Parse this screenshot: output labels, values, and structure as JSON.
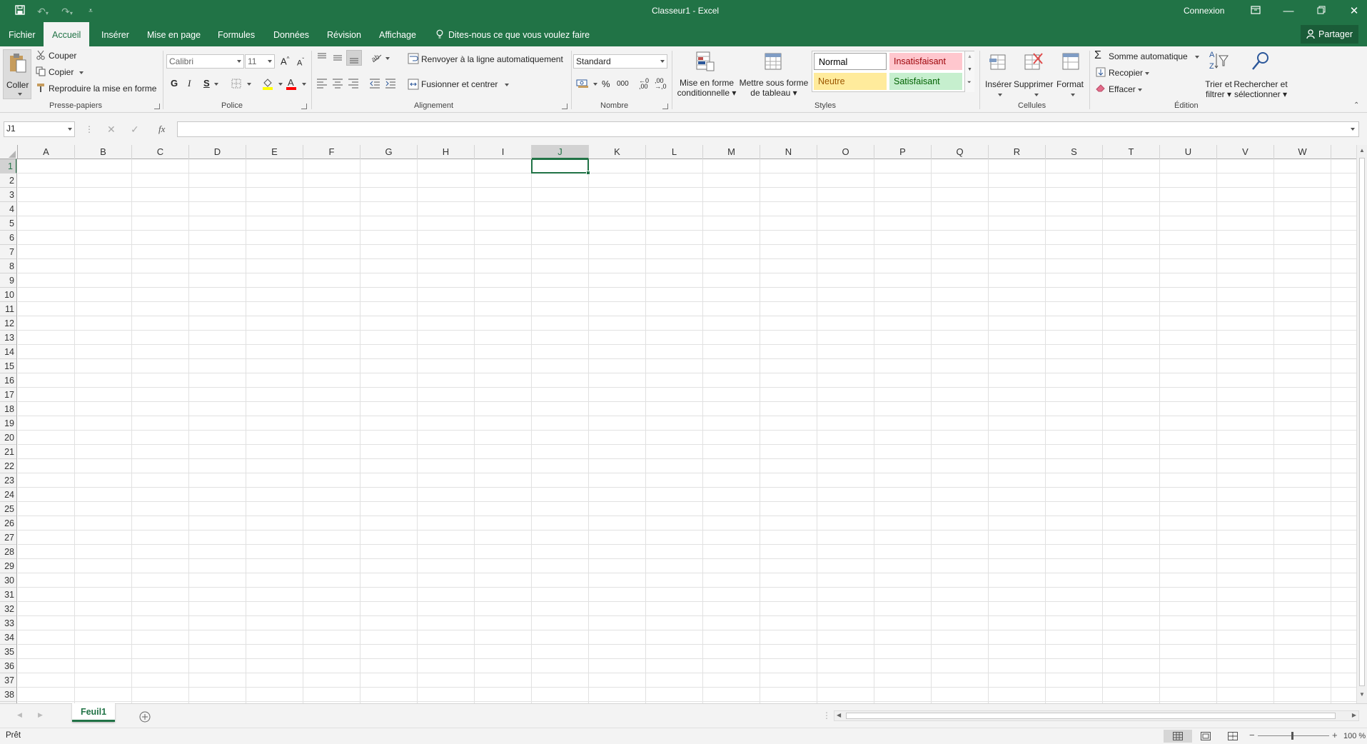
{
  "window": {
    "title": "Classeur1  -  Excel",
    "signin": "Connexion"
  },
  "tabs": [
    "Fichier",
    "Accueil",
    "Insérer",
    "Mise en page",
    "Formules",
    "Données",
    "Révision",
    "Affichage"
  ],
  "tell_me": "Dites-nous ce que vous voulez faire",
  "share": "Partager",
  "ribbon": {
    "clipboard": {
      "paste": "Coller",
      "cut": "Couper",
      "copy": "Copier",
      "format_painter": "Reproduire la mise en forme"
    },
    "font": {
      "name": "Calibri",
      "size": "11",
      "bold": "G",
      "italic": "I",
      "underline": "S"
    },
    "alignment": {
      "wrap_text": "Renvoyer à la ligne automatiquement",
      "merge_center": "Fusionner et centrer"
    },
    "number": {
      "format": "Standard",
      "percent": "%",
      "thousands": "000"
    },
    "styles": {
      "conditional": "Mise en forme conditionnelle ▾",
      "format_table": "Mettre sous forme de tableau ▾",
      "normal": "Normal",
      "bad": "Insatisfaisant",
      "neutral": "Neutre",
      "good": "Satisfaisant"
    },
    "cells": {
      "insert": "Insérer",
      "delete": "Supprimer",
      "format": "Format"
    },
    "editing": {
      "autosum": "Somme automatique",
      "fill": "Recopier",
      "clear": "Effacer",
      "sort_filter": "Trier et filtrer ▾",
      "find_select": "Rechercher et sélectionner ▾"
    },
    "groups": {
      "clipboard": "Presse-papiers",
      "font": "Police",
      "alignment": "Alignement",
      "number": "Nombre",
      "styles": "Styles",
      "cells": "Cellules",
      "editing": "Édition"
    }
  },
  "formula_bar": {
    "name_box": "J1",
    "formula": ""
  },
  "grid": {
    "columns": [
      "A",
      "B",
      "C",
      "D",
      "E",
      "F",
      "G",
      "H",
      "I",
      "J",
      "K",
      "L",
      "M",
      "N",
      "O",
      "P",
      "Q",
      "R",
      "S",
      "T",
      "U",
      "V",
      "W"
    ],
    "rows": [
      "1",
      "2",
      "3",
      "4",
      "5",
      "6",
      "7",
      "8",
      "9",
      "10",
      "11",
      "12",
      "13",
      "14",
      "15",
      "16",
      "17",
      "18",
      "19",
      "20",
      "21",
      "22",
      "23",
      "24",
      "25",
      "26",
      "27",
      "28",
      "29",
      "30",
      "31",
      "32",
      "33",
      "34",
      "35",
      "36",
      "37",
      "38"
    ],
    "active_cell": {
      "column": "J",
      "row": "1"
    }
  },
  "sheets": [
    "Feuil1"
  ],
  "status": {
    "ready": "Prêt",
    "zoom": "100 %"
  }
}
